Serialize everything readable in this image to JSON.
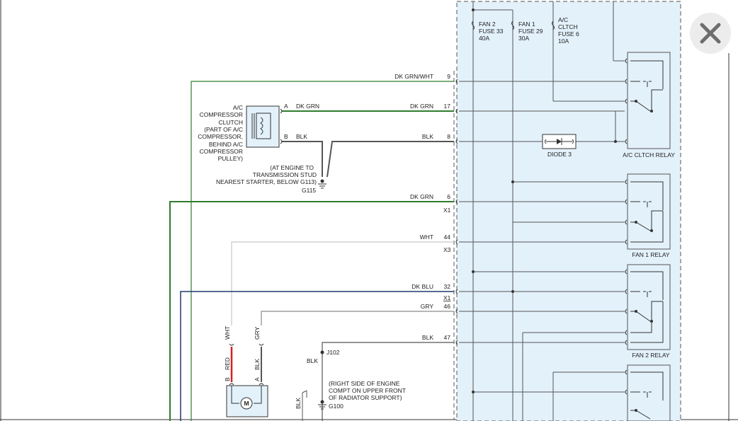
{
  "colors": {
    "dk_grn": "#2e7d2e",
    "dk_blu": "#1f3a6e",
    "wht": "#c8c8c8",
    "gry": "#8a8a8a",
    "blk": "#555555",
    "red": "#d42020",
    "panel": "#e3f1fb"
  },
  "fuses": [
    {
      "name": "FAN 2",
      "fuse": "FUSE 33",
      "rating": "40A"
    },
    {
      "name": "FAN 1",
      "fuse": "FUSE 29",
      "rating": "30A"
    },
    {
      "name": "A/C",
      "name2": "CLTCH",
      "fuse": "FUSE 6",
      "rating": "10A"
    }
  ],
  "relays": {
    "ac": "A/C CLTCH RELAY",
    "fan1": "FAN 1 RELAY",
    "fan2": "FAN 2 RELAY"
  },
  "diode": "DIODE 3",
  "wires": [
    {
      "label": "DK GRN/WHT",
      "pin": "9"
    },
    {
      "label": "DK GRN",
      "pin": "17"
    },
    {
      "label": "BLK",
      "pin": "8"
    },
    {
      "label": "DK GRN",
      "pin": "6",
      "conn": "X1"
    },
    {
      "label": "WHT",
      "pin": "44",
      "conn": "X3"
    },
    {
      "label": "DK BLU",
      "pin": "32",
      "conn": "X1"
    },
    {
      "label": "GRY",
      "pin": "46"
    },
    {
      "label": "BLK",
      "pin": "47"
    }
  ],
  "clutch": {
    "lines": [
      "A/C",
      "COMPRESSOR",
      "CLUTCH",
      "(PART OF A/C",
      "COMPRESSOR,",
      "BEHIND A/C",
      "COMPRESSOR",
      "PULLEY)"
    ],
    "pin_a": "A",
    "pin_b": "B",
    "wire_a": "DK GRN",
    "wire_b": "BLK"
  },
  "ground_g115": {
    "lines": [
      "(AT ENGINE TO",
      "TRANSMISSION STUD",
      "NEAREST STARTER, BELOW G113)"
    ],
    "id": "G115"
  },
  "splice": {
    "id": "J102",
    "wire": "BLK"
  },
  "ground_g100": {
    "lines": [
      "(RIGHT SIDE OF ENGINE",
      "COMPT ON UPPER FRONT",
      "OF RADIATOR SUPPORT)"
    ],
    "id": "G100",
    "wire": "BLK"
  },
  "motor": {
    "symbol": "M",
    "pin_b": "B",
    "pin_a": "A",
    "top_left": "WHT",
    "top_right": "GRY",
    "bot_left": "RED",
    "bot_right": "BLK"
  }
}
